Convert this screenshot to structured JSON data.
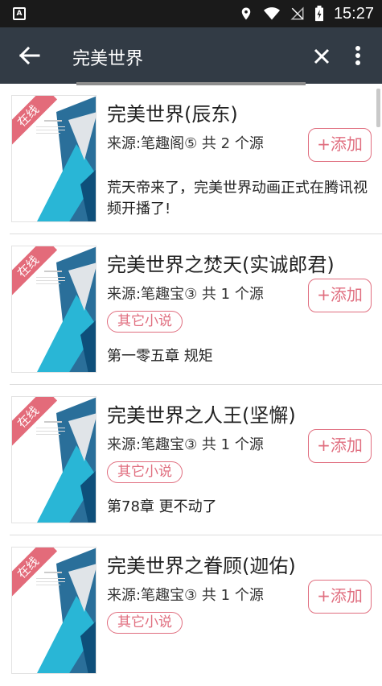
{
  "status_bar": {
    "time": "15:27",
    "icons": [
      "app-notification-icon",
      "location-icon",
      "wifi-icon",
      "no-signal-icon",
      "battery-charging-icon"
    ]
  },
  "app_bar": {
    "title": "完美世界",
    "back_icon": "arrow-back-icon",
    "clear_icon": "close-icon",
    "menu_icon": "more-vert-icon"
  },
  "accent_color": "#e06e7f",
  "results": [
    {
      "badge": "在线",
      "title": "完美世界(辰东)",
      "source": "来源:笔趣阁⑤ 共 2 个源",
      "tag": "",
      "extra": "荒天帝来了，完美世界动画正式在腾讯视频开播了!",
      "add_label": "+添加"
    },
    {
      "badge": "在线",
      "title": "完美世界之焚天(实诚郎君)",
      "source": "来源:笔趣宝③ 共 1 个源",
      "tag": "其它小说",
      "extra": "第一零五章 规矩",
      "add_label": "+添加"
    },
    {
      "badge": "在线",
      "title": "完美世界之人王(坚懈)",
      "source": "来源:笔趣宝③ 共 1 个源",
      "tag": "其它小说",
      "extra": "第78章 更不动了",
      "add_label": "+添加"
    },
    {
      "badge": "在线",
      "title": "完美世界之眷顾(迦佑)",
      "source": "来源:笔趣宝③ 共 1 个源",
      "tag": "其它小说",
      "extra": "",
      "add_label": "+添加"
    }
  ]
}
